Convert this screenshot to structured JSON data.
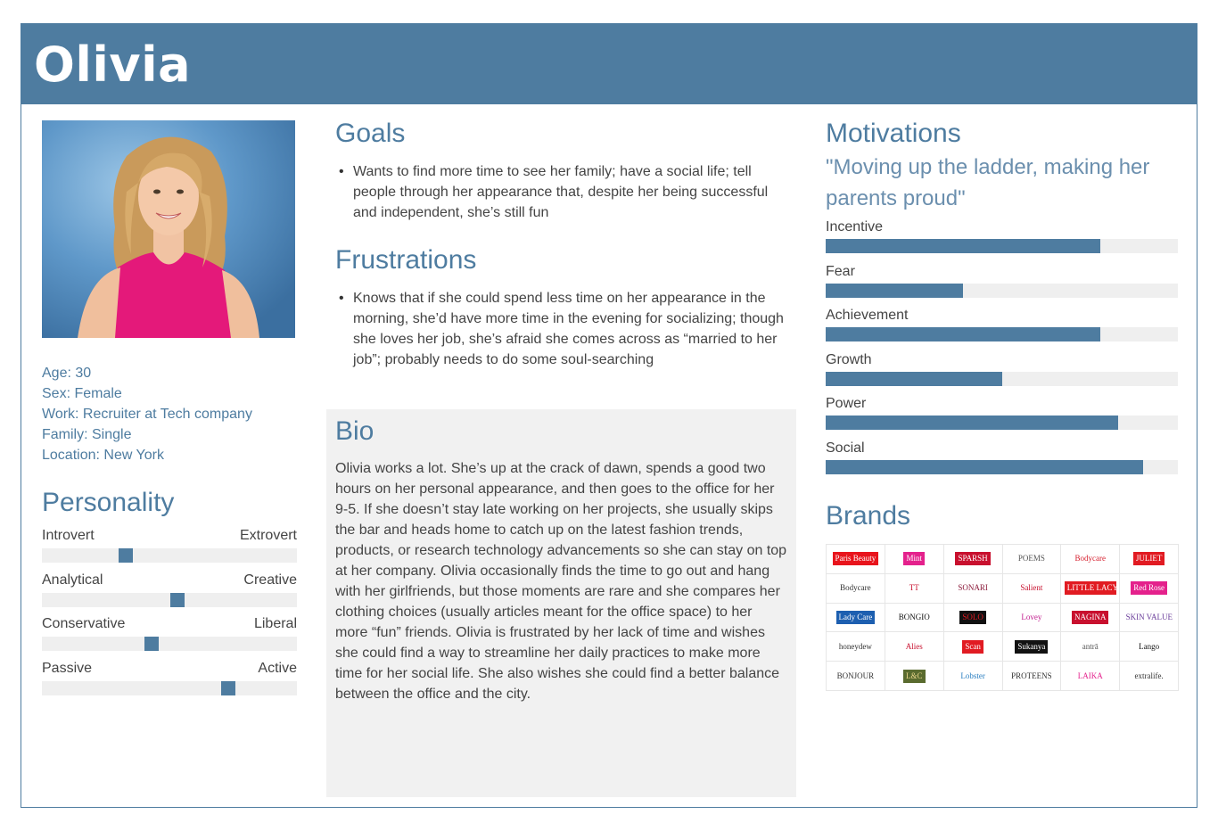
{
  "persona": {
    "name": "Olivia",
    "facts": [
      "Age: 30",
      "Sex: Female",
      "Work: Recruiter at Tech company",
      "Family: Single",
      "Location: New York"
    ]
  },
  "personality": {
    "title": "Personality",
    "traits": [
      {
        "left": "Introvert",
        "right": "Extrovert",
        "value": 0.33
      },
      {
        "left": "Analytical",
        "right": "Creative",
        "value": 0.53
      },
      {
        "left": "Conservative",
        "right": "Liberal",
        "value": 0.43
      },
      {
        "left": "Passive",
        "right": "Active",
        "value": 0.73
      }
    ]
  },
  "goals": {
    "title": "Goals",
    "items": [
      "Wants to find more time to see her family; have a social life; tell people through her appearance that, despite her being successful and independent, she’s still fun"
    ]
  },
  "frustrations": {
    "title": "Frustrations",
    "items": [
      "Knows that if she could spend less time on her appearance in the morning, she’d have more time in the evening for socializing; though she loves her job, she’s afraid she comes across as “married to her job”; probably needs to do some soul-searching"
    ]
  },
  "bio": {
    "title": "Bio",
    "text": "Olivia works a lot. She’s up at the crack of dawn, spends a good two hours on her personal appearance, and then goes to the office for her 9-5. If she doesn’t stay late working on her projects, she usually skips the bar and heads home to catch up on the latest fashion trends, products, or research technology advancements so she can stay on top at her company. Olivia occasionally finds the time to go out and hang with her girlfriends, but those moments are rare and she compares her clothing choices (usually articles meant for the office space) to her more “fun” friends. Olivia is frustrated by her lack of time and wishes she could find a way to streamline her daily practices to make more time for her social life. She also wishes she could find a better balance between the office and the city."
  },
  "motivations": {
    "title": "Motivations",
    "quote": "\"Moving up the ladder, making her parents proud\"",
    "items": [
      {
        "label": "Incentive",
        "value": 0.78
      },
      {
        "label": "Fear",
        "value": 0.39
      },
      {
        "label": "Achievement",
        "value": 0.78
      },
      {
        "label": "Growth",
        "value": 0.5
      },
      {
        "label": "Power",
        "value": 0.83
      },
      {
        "label": "Social",
        "value": 0.9
      }
    ]
  },
  "brands": {
    "title": "Brands",
    "logos": [
      {
        "text": "Paris Beauty",
        "bg": "#e8141c",
        "fg": "#ffffff"
      },
      {
        "text": "Mint",
        "bg": "#e4218c",
        "fg": "#ffffff"
      },
      {
        "text": "SPARSH",
        "bg": "#c8102e",
        "fg": "#ffffff"
      },
      {
        "text": "POEMS",
        "bg": "#ffffff",
        "fg": "#555555"
      },
      {
        "text": "Bodycare",
        "bg": "#ffffff",
        "fg": "#d6202f"
      },
      {
        "text": "JULIET",
        "bg": "#e11b22",
        "fg": "#ffffff"
      },
      {
        "text": "Bodycare",
        "bg": "#ffffff",
        "fg": "#333333"
      },
      {
        "text": "TT",
        "bg": "#ffffff",
        "fg": "#c8102e"
      },
      {
        "text": "SONARI",
        "bg": "#ffffff",
        "fg": "#8b1a3a"
      },
      {
        "text": "Salient",
        "bg": "#ffffff",
        "fg": "#c8102e"
      },
      {
        "text": "LITTLE LACY",
        "bg": "#e11b22",
        "fg": "#ffffff"
      },
      {
        "text": "Red Rose",
        "bg": "#e4218c",
        "fg": "#ffffff"
      },
      {
        "text": "Lady Care",
        "bg": "#1d5fb0",
        "fg": "#ffffff"
      },
      {
        "text": "BONGIO",
        "bg": "#ffffff",
        "fg": "#111111"
      },
      {
        "text": "SOLO",
        "bg": "#111111",
        "fg": "#e11b22"
      },
      {
        "text": "Lovey",
        "bg": "#ffffff",
        "fg": "#c21e8f"
      },
      {
        "text": "NAGINA",
        "bg": "#c8102e",
        "fg": "#ffffff"
      },
      {
        "text": "SKIN VALUE",
        "bg": "#ffffff",
        "fg": "#6a3d9a"
      },
      {
        "text": "honeydew",
        "bg": "#ffffff",
        "fg": "#333333"
      },
      {
        "text": "Alies",
        "bg": "#ffffff",
        "fg": "#c8102e"
      },
      {
        "text": "Scan",
        "bg": "#e11b22",
        "fg": "#ffffff"
      },
      {
        "text": "Sukanya",
        "bg": "#111111",
        "fg": "#ffffff"
      },
      {
        "text": "antrā",
        "bg": "#ffffff",
        "fg": "#555555"
      },
      {
        "text": "Lango",
        "bg": "#ffffff",
        "fg": "#111111"
      },
      {
        "text": "BONJOUR",
        "bg": "#ffffff",
        "fg": "#333333"
      },
      {
        "text": "L&C",
        "bg": "#5a6b2f",
        "fg": "#e8d48a"
      },
      {
        "text": "Lobster",
        "bg": "#ffffff",
        "fg": "#2a7fc1"
      },
      {
        "text": "PROTEENS",
        "bg": "#ffffff",
        "fg": "#333333"
      },
      {
        "text": "LAIKA",
        "bg": "#ffffff",
        "fg": "#e4218c"
      },
      {
        "text": "extralife.",
        "bg": "#ffffff",
        "fg": "#333333"
      }
    ]
  },
  "colors": {
    "accent": "#4e7ca0",
    "track": "#efefef",
    "bio_bg": "#f1f1f1"
  }
}
